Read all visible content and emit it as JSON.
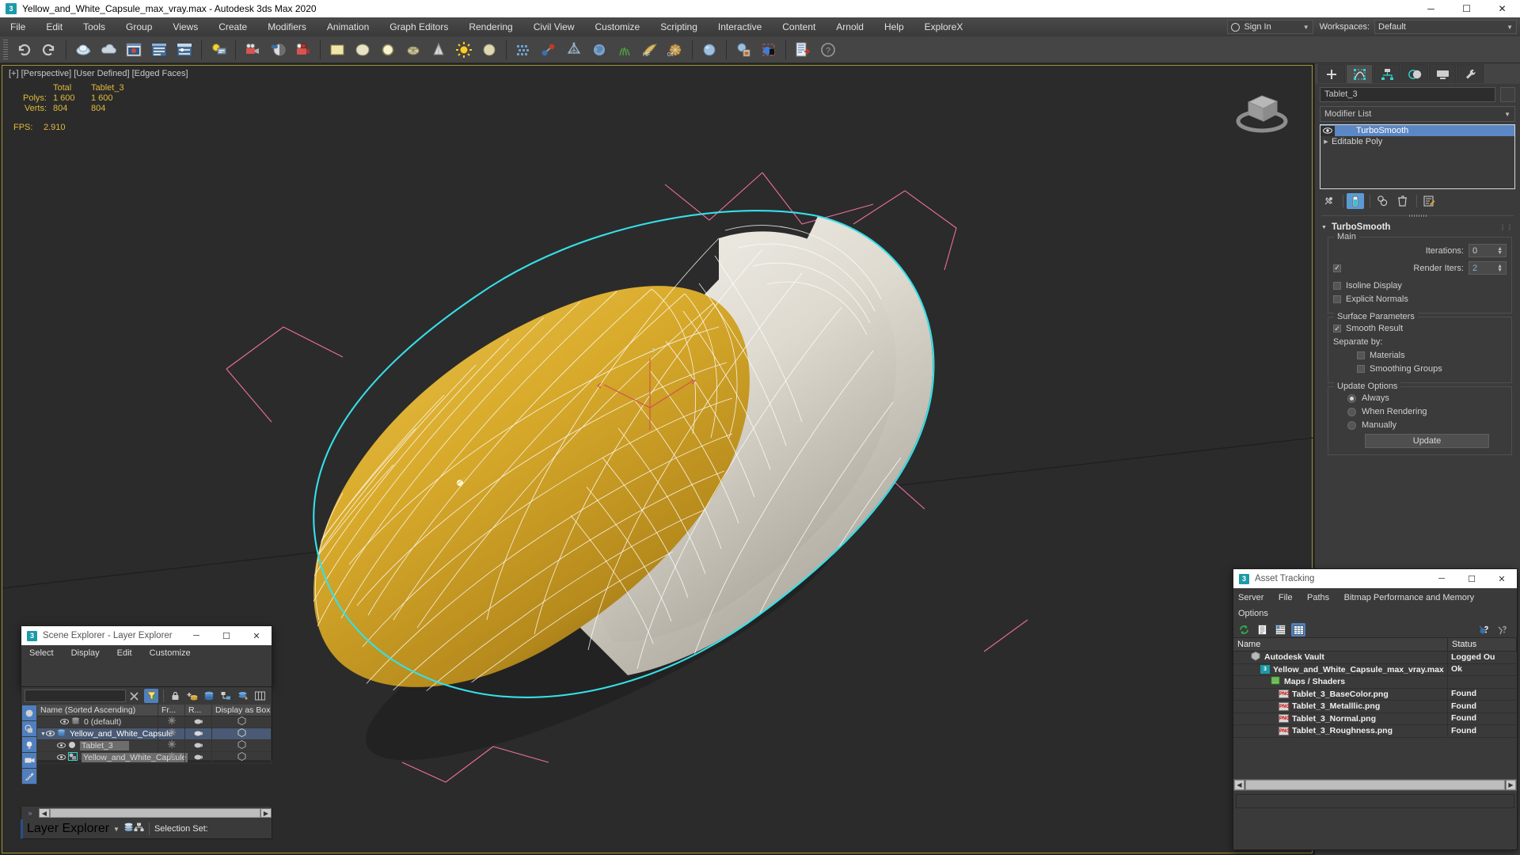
{
  "titlebar": {
    "title": "Yellow_and_White_Capsule_max_vray.max - Autodesk 3ds Max 2020",
    "app_badge": "3",
    "minimize": "─",
    "maximize": "☐",
    "close": "✕"
  },
  "menubar": {
    "items": [
      "File",
      "Edit",
      "Tools",
      "Group",
      "Views",
      "Create",
      "Modifiers",
      "Animation",
      "Graph Editors",
      "Rendering",
      "Civil View",
      "Customize",
      "Scripting",
      "Interactive",
      "Content",
      "Arnold",
      "Help",
      "ExploreX"
    ],
    "signin_label": "Sign In",
    "workspaces_label": "Workspaces:",
    "workspace_value": "Default"
  },
  "toolbar": {
    "icons": [
      "undo-icon",
      "redo-icon",
      "select-link-icon",
      "unlink-icon",
      "bind-spacewarp-icon",
      "select-object-icon",
      "select-by-name-icon",
      "select-region-icon",
      "window-crossing-icon",
      "select-and-move-icon",
      "select-and-rotate-icon",
      "select-and-scale-icon",
      "placement-icon",
      "reference-coordinate-icon",
      "use-pivot-icon",
      "select-and-manipulate-icon",
      "snaps-toggle-icon",
      "angle-snap-icon",
      "percent-snap-icon",
      "spinner-snap-icon",
      "named-selection-icon",
      "mirror-icon",
      "align-icon",
      "layer-explorer-icon",
      "scene-explorer-icon",
      "ribbon-icon",
      "curve-editor-icon",
      "schematic-view-icon",
      "material-editor-icon",
      "render-setup-icon",
      "rendered-frame-icon",
      "render-production-icon",
      "open-asset-tracking-icon",
      "help-icon"
    ]
  },
  "viewport": {
    "label": "[+] [Perspective] [User Defined] [Edged Faces]",
    "stats": {
      "col_total": "Total",
      "col_object": "Tablet_3",
      "rows": [
        {
          "label": "Polys:",
          "total": "1 600",
          "object": "1 600"
        },
        {
          "label": "Verts:",
          "total": "804",
          "object": "804"
        }
      ],
      "fps_label": "FPS:",
      "fps_value": "2.910"
    },
    "colors": {
      "capsule_yellow": "#d3a727",
      "capsule_white": "#d9d5cd",
      "selection_highlight": "#35e0e8",
      "gizmo_pink": "#ef6fa0",
      "background": "#2b2b2b"
    }
  },
  "command_panel": {
    "tabs": [
      {
        "name": "create-tab",
        "glyph": "+",
        "active": false
      },
      {
        "name": "modify-tab",
        "glyph": "modify",
        "active": true
      },
      {
        "name": "hierarchy-tab",
        "glyph": "hierarchy",
        "active": false
      },
      {
        "name": "motion-tab",
        "glyph": "motion",
        "active": false
      },
      {
        "name": "display-tab",
        "glyph": "display",
        "active": false
      },
      {
        "name": "utilities-tab",
        "glyph": "wrench",
        "active": false
      }
    ],
    "object_name": "Tablet_3",
    "modifier_list_label": "Modifier List",
    "stack": [
      {
        "label": "TurboSmooth",
        "selected": true,
        "has_eye": true,
        "has_arrow": false
      },
      {
        "label": "Editable Poly",
        "selected": false,
        "has_eye": false,
        "has_arrow": true
      }
    ],
    "stack_buttons": [
      "pin-stack-icon",
      "show-end-result-icon",
      "make-unique-icon",
      "remove-modifier-icon",
      "configure-modifier-sets-icon"
    ],
    "rollout": {
      "title": "TurboSmooth",
      "main_group": "Main",
      "iterations_label": "Iterations:",
      "iterations_value": "0",
      "render_iters_label": "Render Iters:",
      "render_iters_value": "2",
      "render_iters_checked": true,
      "isoline_display": "Isoline Display",
      "isoline_checked": false,
      "explicit_normals": "Explicit Normals",
      "explicit_checked": false,
      "surface_group": "Surface Parameters",
      "smooth_result": "Smooth Result",
      "smooth_result_checked": true,
      "separate_by": "Separate by:",
      "materials": "Materials",
      "materials_checked": false,
      "smoothing_groups": "Smoothing Groups",
      "smoothing_groups_checked": false,
      "update_group": "Update Options",
      "update_options": [
        {
          "label": "Always",
          "selected": true
        },
        {
          "label": "When Rendering",
          "selected": false
        },
        {
          "label": "Manually",
          "selected": false
        }
      ],
      "update_button": "Update"
    }
  },
  "scene_explorer": {
    "title": "Scene Explorer - Layer Explorer",
    "app_badge": "3",
    "window_buttons": {
      "minimize": "─",
      "maximize": "☐",
      "close": "✕"
    },
    "menu": [
      "Select",
      "Display",
      "Edit",
      "Customize"
    ],
    "search_value": "",
    "toolbar_icons": [
      "clear-search-icon",
      "filter-icon",
      "lock-icon",
      "add-layer-icon",
      "layers-icon",
      "hierarchy-icon",
      "sort-icon",
      "columns-icon"
    ],
    "left_toolbar_icons": [
      "geometry-filter-icon",
      "shapes-filter-icon",
      "lights-filter-icon",
      "cameras-filter-icon",
      "helpers-filter-icon"
    ],
    "columns": [
      "Name (Sorted Ascending)",
      "Fr...",
      "R...",
      "Display as Box"
    ],
    "rows": [
      {
        "name": "0 (default)",
        "indent": 1,
        "type": "layer",
        "selected": false,
        "expander": ""
      },
      {
        "name": "Yellow_and_White_Capsule",
        "indent": 1,
        "type": "layer",
        "selected": true,
        "expander": "▼"
      },
      {
        "name": "Tablet_3",
        "indent": 2,
        "type": "object",
        "selected": false,
        "expander": ""
      },
      {
        "name": "Yellow_and_White_Capsule",
        "indent": 2,
        "type": "group",
        "selected": false,
        "expander": ""
      }
    ],
    "footer_dropdown": "Layer Explorer",
    "footer_selection_set": "Selection Set:"
  },
  "asset_tracking": {
    "title": "Asset Tracking",
    "app_badge": "3",
    "window_buttons": {
      "minimize": "─",
      "maximize": "☐",
      "close": "✕"
    },
    "menu": [
      "Server",
      "File",
      "Paths",
      "Bitmap Performance and Memory",
      "Options"
    ],
    "toolbar_icons": [
      "refresh-icon",
      "list-view-icon",
      "detail-view-icon",
      "grid-view-icon",
      "check-out-icon",
      "check-in-icon"
    ],
    "columns": [
      "Name",
      "Status"
    ],
    "rows": [
      {
        "name": "Autodesk Vault",
        "status": "Logged Ou",
        "indent": 1,
        "icon": "vault-icon"
      },
      {
        "name": "Yellow_and_White_Capsule_max_vray.max",
        "status": "Ok",
        "indent": 2,
        "icon": "max-file-icon"
      },
      {
        "name": "Maps / Shaders",
        "status": "",
        "indent": 3,
        "icon": "maps-icon"
      },
      {
        "name": "Tablet_3_BaseColor.png",
        "status": "Found",
        "indent": 4,
        "icon": "png-icon"
      },
      {
        "name": "Tablet_3_Metalllic.png",
        "status": "Found",
        "indent": 4,
        "icon": "png-icon"
      },
      {
        "name": "Tablet_3_Normal.png",
        "status": "Found",
        "indent": 4,
        "icon": "png-icon"
      },
      {
        "name": "Tablet_3_Roughness.png",
        "status": "Found",
        "indent": 4,
        "icon": "png-icon"
      }
    ]
  }
}
